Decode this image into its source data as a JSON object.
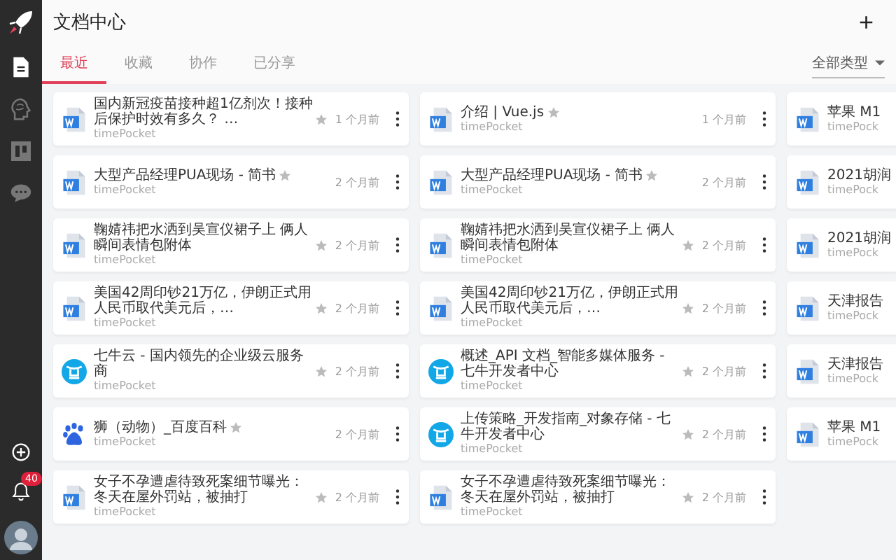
{
  "sidebar": {
    "items": [
      {
        "kind": "document",
        "selected": true
      },
      {
        "kind": "brain",
        "selected": false
      },
      {
        "kind": "board",
        "selected": false
      },
      {
        "kind": "chat",
        "selected": false
      }
    ],
    "notification_count": "40"
  },
  "header": {
    "title": "文档中心",
    "add_button": "+"
  },
  "tabs": [
    {
      "label": "最近",
      "selected": true
    },
    {
      "label": "收藏",
      "selected": false
    },
    {
      "label": "协作",
      "selected": false
    },
    {
      "label": "已分享",
      "selected": false
    }
  ],
  "type_filter": {
    "value": "全部类型"
  },
  "column_1": [
    {
      "kind": "word",
      "title": "国内新冠疫苗接种超1亿剂次！接种后保护时效有多久？ …",
      "source": "timePocket",
      "time": "1 个月前"
    },
    {
      "kind": "word",
      "title": "大型产品经理PUA现场 - 简书",
      "source": "timePocket",
      "time": "2 个月前"
    },
    {
      "kind": "word",
      "title": "鞠婧祎把水洒到吴宣仪裙子上 俩人瞬间表情包附体",
      "source": "timePocket",
      "time": "2 个月前"
    },
    {
      "kind": "word",
      "title": "美国42周印钞21万亿，伊朗正式用人民币取代美元后，…",
      "source": "timePocket",
      "time": "2 个月前"
    },
    {
      "kind": "qiniu",
      "title": "七牛云 - 国内领先的企业级云服务商",
      "source": "timePocket",
      "time": "2 个月前"
    },
    {
      "kind": "baidu",
      "title": "狮（动物）_百度百科",
      "source": "timePocket",
      "time": "2 个月前"
    },
    {
      "kind": "word",
      "title": "女子不孕遭虐待致死案细节曝光：冬天在屋外罚站，被抽打",
      "source": "timePocket",
      "time": "2 个月前"
    }
  ],
  "column_2": [
    {
      "kind": "word",
      "title": "介绍 | Vue.js",
      "source": "timePocket",
      "time": "1 个月前"
    },
    {
      "kind": "word",
      "title": "大型产品经理PUA现场 - 简书",
      "source": "timePocket",
      "time": "2 个月前"
    },
    {
      "kind": "word",
      "title": "鞠婧祎把水洒到吴宣仪裙子上 俩人瞬间表情包附体",
      "source": "timePocket",
      "time": "2 个月前"
    },
    {
      "kind": "word",
      "title": "美国42周印钞21万亿，伊朗正式用人民币取代美元后，…",
      "source": "timePocket",
      "time": "2 个月前"
    },
    {
      "kind": "qiniu",
      "title": "概述_API 文档_智能多媒体服务 - 七牛开发者中心",
      "source": "timePocket",
      "time": "2 个月前"
    },
    {
      "kind": "qiniu",
      "title": "上传策略_开发指南_对象存储 - 七牛开发者中心",
      "source": "timePocket",
      "time": "2 个月前"
    },
    {
      "kind": "word",
      "title": "女子不孕遭虐待致死案细节曝光：冬天在屋外罚站，被抽打",
      "source": "timePocket",
      "time": "2 个月前"
    }
  ],
  "column_3": [
    {
      "kind": "word",
      "title": "苹果 M1",
      "source": "timePock"
    },
    {
      "kind": "word",
      "title": "2021胡润",
      "source": "timePock"
    },
    {
      "kind": "word",
      "title": "2021胡润",
      "source": "timePock"
    },
    {
      "kind": "word",
      "title": "天津报告",
      "source": "timePock"
    },
    {
      "kind": "word",
      "title": "天津报告",
      "source": "timePock"
    },
    {
      "kind": "word",
      "title": "苹果 M1",
      "source": "timePock"
    }
  ]
}
